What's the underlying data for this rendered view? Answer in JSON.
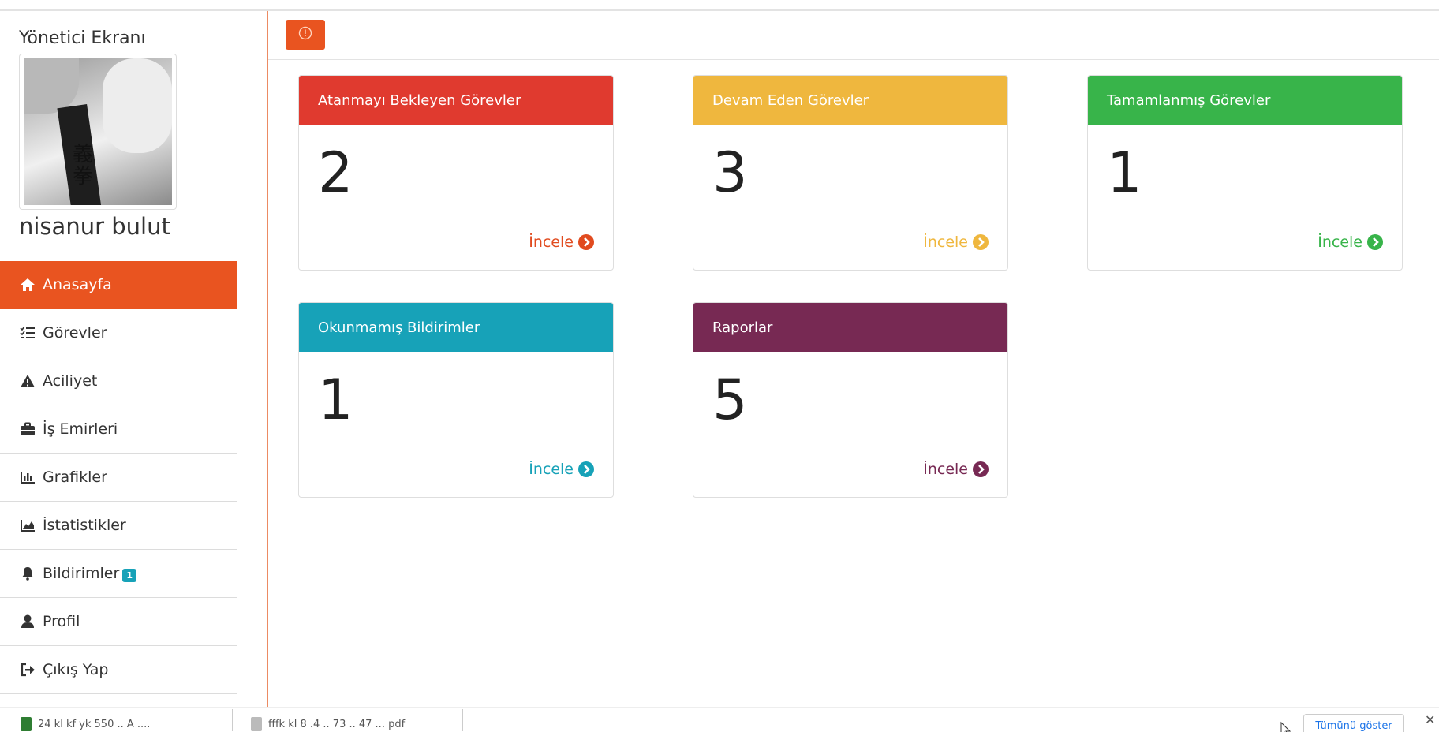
{
  "sidebar": {
    "title": "Yönetici Ekranı",
    "user_name": "nisanur bulut",
    "items": [
      {
        "label": "Anasayfa",
        "icon": "home-icon",
        "active": true
      },
      {
        "label": "Görevler",
        "icon": "list-check-icon"
      },
      {
        "label": "Aciliyet",
        "icon": "warning-icon"
      },
      {
        "label": "İş Emirleri",
        "icon": "briefcase-icon"
      },
      {
        "label": "Grafikler",
        "icon": "bar-chart-icon"
      },
      {
        "label": "İstatistikler",
        "icon": "area-chart-icon"
      },
      {
        "label": "Bildirimler",
        "icon": "bell-icon",
        "badge": "1"
      },
      {
        "label": "Profil",
        "icon": "user-icon"
      },
      {
        "label": "Çıkış Yap",
        "icon": "sign-out-icon"
      }
    ]
  },
  "topbar": {
    "alert_icon": "alert-circle-icon",
    "accent": "#e95420"
  },
  "cards": [
    {
      "title": "Atanmayı Bekleyen Görevler",
      "count": "2",
      "link": "İncele",
      "color": "#e03a2f",
      "link_color": "#e14b1f"
    },
    {
      "title": "Devam Eden Görevler",
      "count": "3",
      "link": "İncele",
      "color": "#efb73e",
      "link_color": "#efb73e"
    },
    {
      "title": "Tamamlanmış Görevler",
      "count": "1",
      "link": "İncele",
      "color": "#38b44a",
      "link_color": "#38b44a"
    },
    {
      "title": "Okunmamış Bildirimler",
      "count": "1",
      "link": "İncele",
      "color": "#17a2b8",
      "link_color": "#17a2b8"
    },
    {
      "title": "Raporlar",
      "count": "5",
      "link": "İncele",
      "color": "#772953",
      "link_color": "#772953"
    }
  ],
  "download_bar": {
    "item1": "24 kl kf yk 550 .. A ....",
    "item2": "fffk kl 8 .4 .. 73 .. 47 ... pdf",
    "show_all": "Tümünü göster"
  }
}
